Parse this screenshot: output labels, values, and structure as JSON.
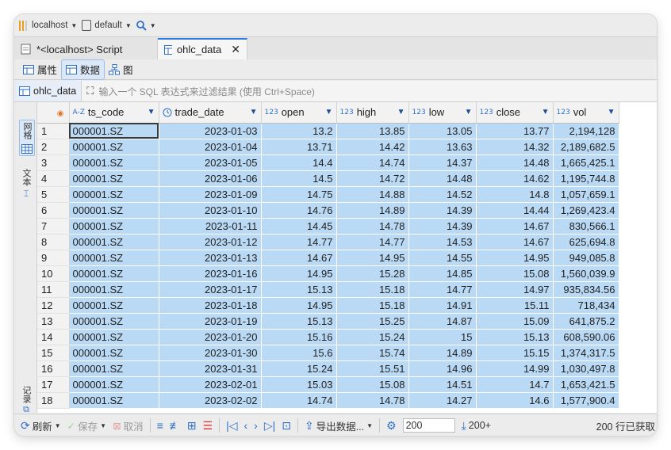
{
  "toolbar": {
    "connection": "localhost",
    "schema": "default"
  },
  "tabs": [
    {
      "label": "*<localhost> Script"
    },
    {
      "label": "ohlc_data"
    }
  ],
  "subtabs": {
    "properties": "属性",
    "data": "数据",
    "diagram": "图"
  },
  "filter": {
    "table_name": "ohlc_data",
    "placeholder": "输入一个 SQL 表达式来过滤结果 (使用 Ctrl+Space)"
  },
  "side": {
    "grid": "网格",
    "text": "文本",
    "record": "记录"
  },
  "columns": [
    {
      "name": "ts_code",
      "type": "A-Z"
    },
    {
      "name": "trade_date",
      "type": "clock"
    },
    {
      "name": "open",
      "type": "123"
    },
    {
      "name": "high",
      "type": "123"
    },
    {
      "name": "low",
      "type": "123"
    },
    {
      "name": "close",
      "type": "123"
    },
    {
      "name": "vol",
      "type": "123"
    }
  ],
  "rows": [
    [
      "1",
      "000001.SZ",
      "2023-01-03",
      "13.2",
      "13.85",
      "13.05",
      "13.77",
      "2,194,128"
    ],
    [
      "2",
      "000001.SZ",
      "2023-01-04",
      "13.71",
      "14.42",
      "13.63",
      "14.32",
      "2,189,682.5"
    ],
    [
      "3",
      "000001.SZ",
      "2023-01-05",
      "14.4",
      "14.74",
      "14.37",
      "14.48",
      "1,665,425.1"
    ],
    [
      "4",
      "000001.SZ",
      "2023-01-06",
      "14.5",
      "14.72",
      "14.48",
      "14.62",
      "1,195,744.8"
    ],
    [
      "5",
      "000001.SZ",
      "2023-01-09",
      "14.75",
      "14.88",
      "14.52",
      "14.8",
      "1,057,659.1"
    ],
    [
      "6",
      "000001.SZ",
      "2023-01-10",
      "14.76",
      "14.89",
      "14.39",
      "14.44",
      "1,269,423.4"
    ],
    [
      "7",
      "000001.SZ",
      "2023-01-11",
      "14.45",
      "14.78",
      "14.39",
      "14.67",
      "830,566.1"
    ],
    [
      "8",
      "000001.SZ",
      "2023-01-12",
      "14.77",
      "14.77",
      "14.53",
      "14.67",
      "625,694.8"
    ],
    [
      "9",
      "000001.SZ",
      "2023-01-13",
      "14.67",
      "14.95",
      "14.55",
      "14.95",
      "949,085.8"
    ],
    [
      "10",
      "000001.SZ",
      "2023-01-16",
      "14.95",
      "15.28",
      "14.85",
      "15.08",
      "1,560,039.9"
    ],
    [
      "11",
      "000001.SZ",
      "2023-01-17",
      "15.13",
      "15.18",
      "14.77",
      "14.97",
      "935,834.56"
    ],
    [
      "12",
      "000001.SZ",
      "2023-01-18",
      "14.95",
      "15.18",
      "14.91",
      "15.11",
      "718,434"
    ],
    [
      "13",
      "000001.SZ",
      "2023-01-19",
      "15.13",
      "15.25",
      "14.87",
      "15.09",
      "641,875.2"
    ],
    [
      "14",
      "000001.SZ",
      "2023-01-20",
      "15.16",
      "15.24",
      "15",
      "15.13",
      "608,590.06"
    ],
    [
      "15",
      "000001.SZ",
      "2023-01-30",
      "15.6",
      "15.74",
      "14.89",
      "15.15",
      "1,374,317.5"
    ],
    [
      "16",
      "000001.SZ",
      "2023-01-31",
      "15.24",
      "15.51",
      "14.96",
      "14.99",
      "1,030,497.8"
    ],
    [
      "17",
      "000001.SZ",
      "2023-02-01",
      "15.03",
      "15.08",
      "14.51",
      "14.7",
      "1,653,421.5"
    ],
    [
      "18",
      "000001.SZ",
      "2023-02-02",
      "14.74",
      "14.78",
      "14.27",
      "14.6",
      "1,577,900.4"
    ]
  ],
  "bottom": {
    "refresh": "刷新",
    "save": "保存",
    "cancel": "取消",
    "export": "导出数据...",
    "fetch_size": "200",
    "fetch_more": "200+",
    "status": "200 行已获取"
  }
}
